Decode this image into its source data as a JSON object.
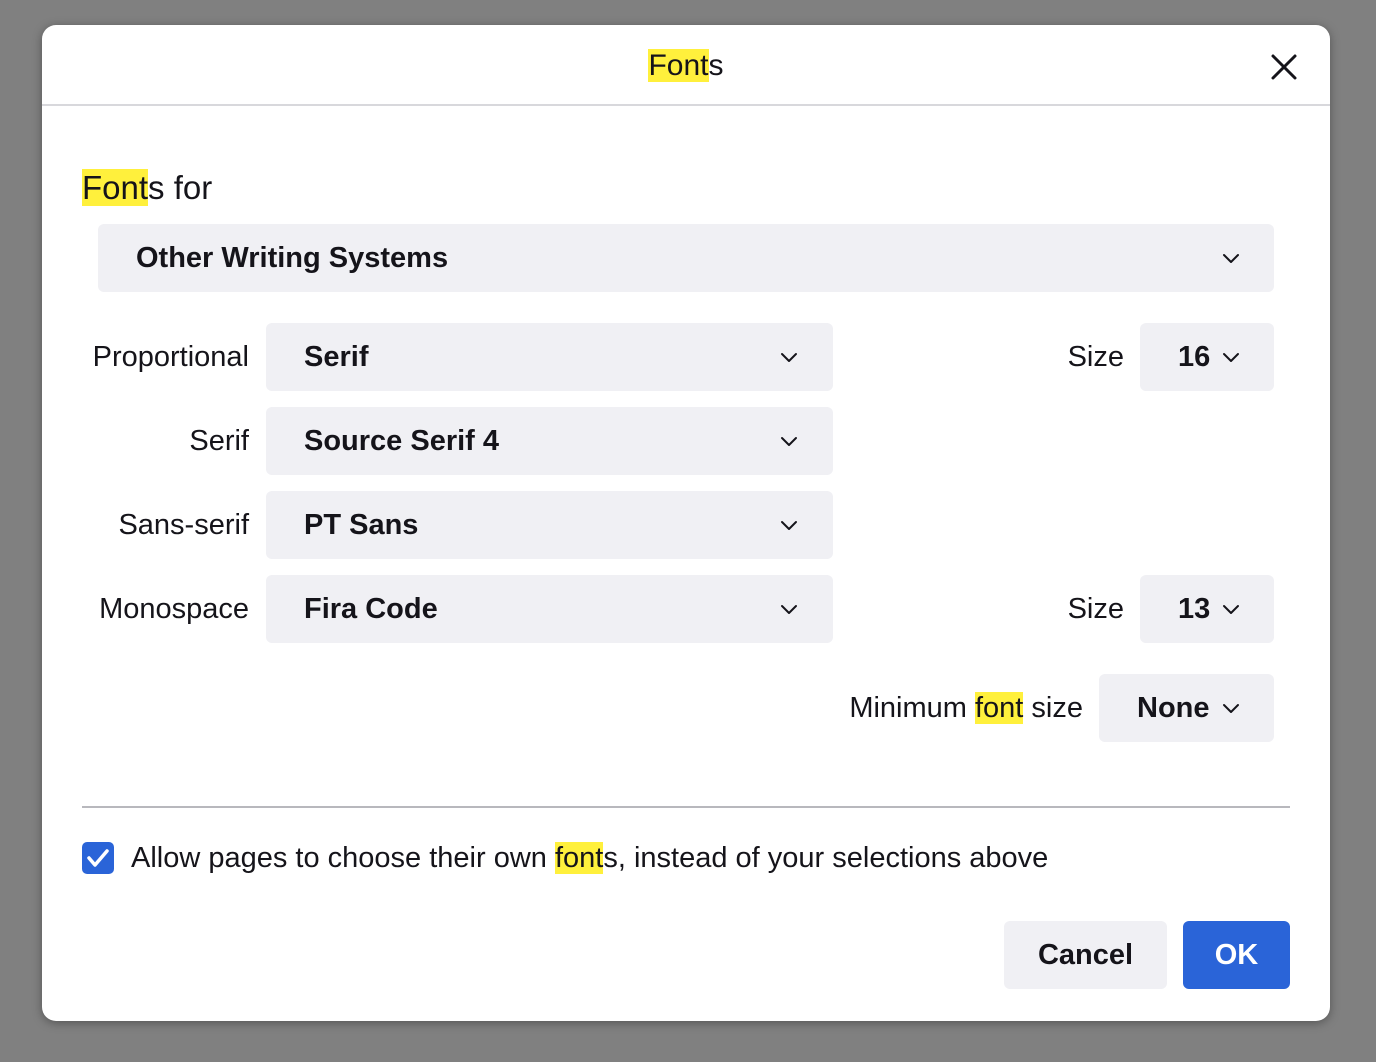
{
  "dialog": {
    "title_highlight": "Font",
    "title_rest": "s",
    "close_icon": "close-icon"
  },
  "fonts_for": {
    "label_highlight": "Font",
    "label_rest": "s for",
    "selected": "Other Writing Systems"
  },
  "proportional": {
    "label": "Proportional",
    "selected": "Serif",
    "size_label": "Size",
    "size_value": "16"
  },
  "serif": {
    "label": "Serif",
    "selected": "Source Serif 4"
  },
  "sans_serif": {
    "label": "Sans-serif",
    "selected": "PT Sans"
  },
  "monospace": {
    "label": "Monospace",
    "selected": "Fira Code",
    "size_label": "Size",
    "size_value": "13"
  },
  "minimum_size": {
    "label_before": "Minimum ",
    "label_highlight": "font",
    "label_after": " size",
    "selected": "None"
  },
  "allow_pages": {
    "checked": true,
    "label_before": "Allow pages to choose their own ",
    "label_highlight": "font",
    "label_after": "s, instead of your selections above"
  },
  "buttons": {
    "cancel": "Cancel",
    "ok": "OK"
  },
  "colors": {
    "accent": "#2a64d8",
    "highlight": "#fff03c",
    "field_bg": "#f0f0f4"
  }
}
